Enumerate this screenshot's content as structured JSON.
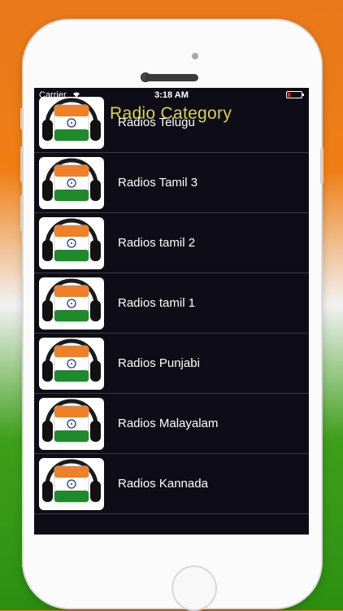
{
  "status_bar": {
    "carrier": "Carrier",
    "time": "3:18 AM"
  },
  "nav": {
    "title": "Radio Category",
    "menu_icon": "grid-menu-icon"
  },
  "colors": {
    "title": "#dcd24a",
    "screen_bg": "#0d0c17",
    "saffron": "#f07f2a",
    "green": "#1f8a2a",
    "chakra": "#1f3a93"
  },
  "categories": [
    {
      "label": "Radios Telugu"
    },
    {
      "label": "Radios Tamil 3"
    },
    {
      "label": "Radios tamil 2"
    },
    {
      "label": "Radios tamil 1"
    },
    {
      "label": "Radios Punjabi"
    },
    {
      "label": "Radios Malayalam"
    },
    {
      "label": "Radios Kannada"
    }
  ]
}
